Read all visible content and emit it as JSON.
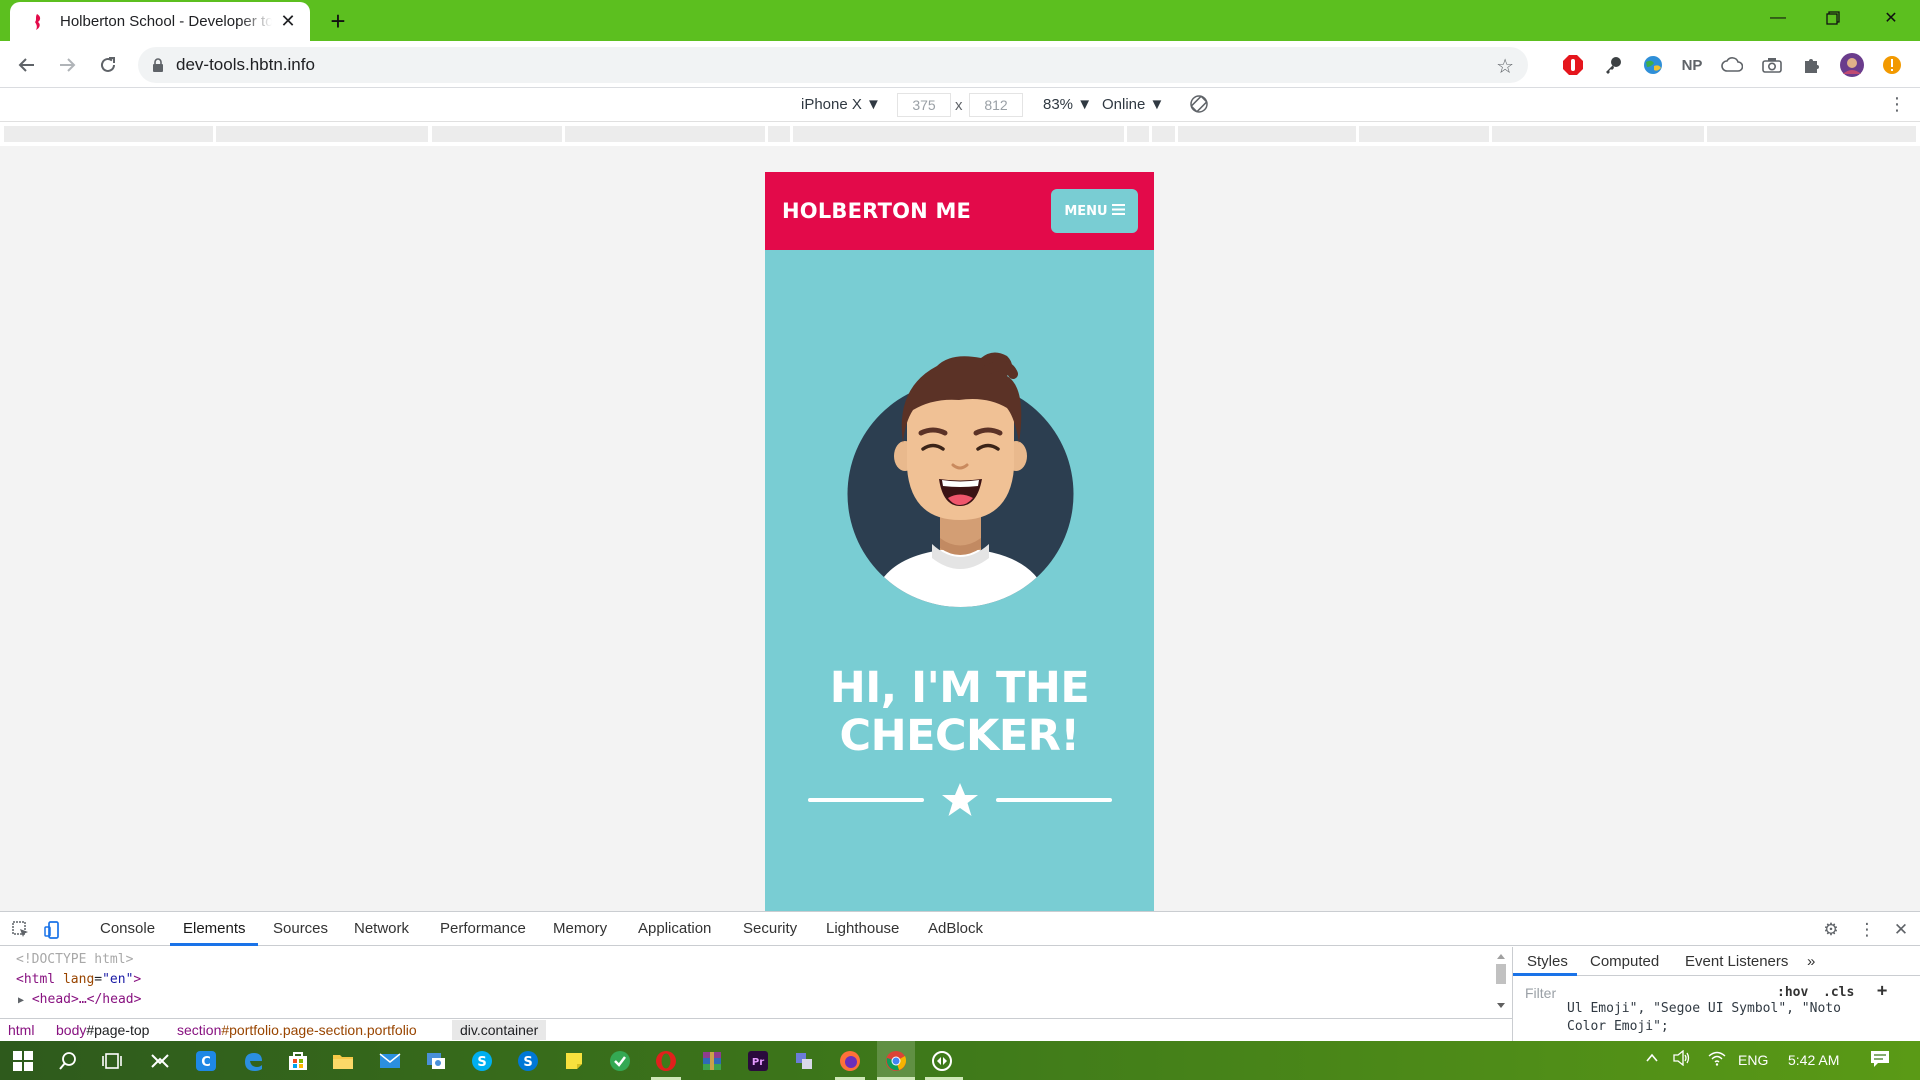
{
  "browser": {
    "tab_title": "Holberton School - Developer tools",
    "url": "dev-tools.hbtn.info",
    "extensions": [
      "adblock-icon",
      "key-icon",
      "globe-icon",
      "NP",
      "cloud-icon",
      "camera-icon",
      "puzzle-icon",
      "avatar",
      "update-icon"
    ]
  },
  "device_toolbar": {
    "device": "iPhone X ▼",
    "width": "375",
    "times": "x",
    "height": "812",
    "zoom": "83% ▼",
    "network": "Online ▼"
  },
  "site": {
    "brand": "HOLBERTON ME",
    "menu_label": "MENU",
    "hero_line1": "HI, I'M THE",
    "hero_line2": "CHECKER!"
  },
  "devtools": {
    "tabs": [
      "Console",
      "Elements",
      "Sources",
      "Network",
      "Performance",
      "Memory",
      "Application",
      "Security",
      "Lighthouse",
      "AdBlock"
    ],
    "active_tab": "Elements",
    "code": {
      "doctype": "<!DOCTYPE html>",
      "html_open": "<html",
      "lang_attr": "lang",
      "lang_val": "\"en\"",
      "html_close": ">",
      "head": "<head>…</head>"
    },
    "breadcrumbs": [
      {
        "tag": "html",
        "rest": ""
      },
      {
        "tag": "body",
        "rest": "#page-top"
      },
      {
        "tag": "section",
        "rest": "#portfolio.page-section.portfolio"
      },
      {
        "tag": "div",
        "rest": ".container"
      }
    ],
    "styles_tabs": [
      "Styles",
      "Computed",
      "Event Listeners",
      "»"
    ],
    "filter_placeholder": "Filter",
    "hov": ":hov",
    "cls": ".cls",
    "plus": "+",
    "style_code_line1": "Ul Emoji\", \"Segoe UI Symbol\", \"Noto",
    "style_code_line2": "Color Emoji\";"
  },
  "taskbar": {
    "language": "ENG",
    "time": "5:42 AM"
  },
  "colors": {
    "titlebar": "#5cbf1f",
    "site_nav": "#e30a4a",
    "site_bg": "#79cdd3",
    "avatar_circle": "#2c3e50"
  }
}
